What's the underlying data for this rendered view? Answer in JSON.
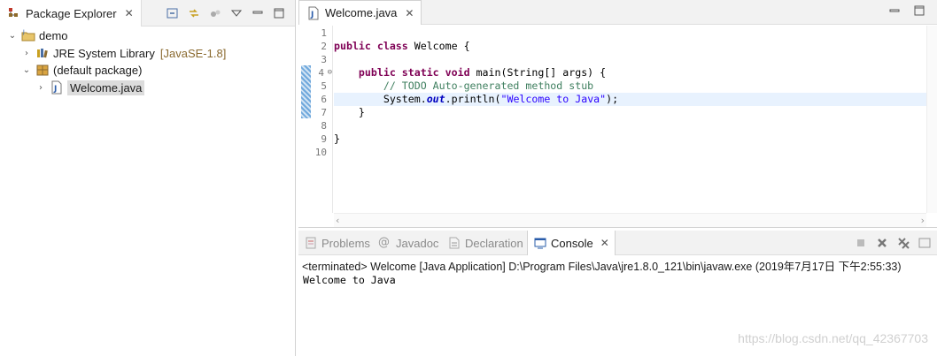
{
  "explorer": {
    "title": "Package Explorer",
    "tree": [
      {
        "label": "demo",
        "decoration": "",
        "icon": "java-project-icon",
        "twisty": "expanded"
      },
      {
        "label": "JRE System Library",
        "decoration": "[JavaSE-1.8]",
        "icon": "library-icon",
        "twisty": "collapsed"
      },
      {
        "label": "(default package)",
        "decoration": "",
        "icon": "package-icon",
        "twisty": "expanded"
      },
      {
        "label": "Welcome.java",
        "decoration": "",
        "icon": "java-file-icon",
        "twisty": "collapsed",
        "selected": true
      }
    ]
  },
  "editor": {
    "tab_title": "Welcome.java",
    "line_numbers": [
      "1",
      "2",
      "3",
      "4",
      "5",
      "6",
      "7",
      "8",
      "9",
      "10"
    ],
    "fold_marker_line": "4",
    "current_line": "6",
    "code": {
      "l2_kw": "public class",
      "l2_rest": " Welcome {",
      "l4_indent": "    ",
      "l4_kw": "public static void",
      "l4_rest": " main(String[] args) {",
      "l5": "        // TODO Auto-generated method stub",
      "l6_pre": "        System.",
      "l6_field": "out",
      "l6_mid": ".println(",
      "l6_str": "\"Welcome to Java\"",
      "l6_post": ");",
      "l7": "    }",
      "l9": "}"
    }
  },
  "console": {
    "tabs": [
      {
        "label": "Problems",
        "icon": "problems-icon"
      },
      {
        "label": "Javadoc",
        "icon": "at-icon"
      },
      {
        "label": "Declaration",
        "icon": "declaration-icon"
      },
      {
        "label": "Console",
        "icon": "console-icon",
        "active": true
      }
    ],
    "status": "<terminated> Welcome [Java Application] D:\\Program Files\\Java\\jre1.8.0_121\\bin\\javaw.exe (2019年7月17日 下午2:55:33)",
    "output": "Welcome to Java"
  },
  "watermark": "https://blog.csdn.net/qq_42367703",
  "colors": {
    "keyword": "#7f0055",
    "comment": "#3f7f5f",
    "string": "#2a00ff",
    "field": "#0000c0",
    "current_line": "#e8f2fe"
  }
}
